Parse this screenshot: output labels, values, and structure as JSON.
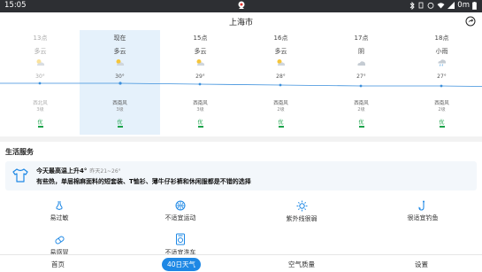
{
  "status_bar": {
    "time": "15:05",
    "bluetooth_icon": "bluetooth-icon",
    "signal_text": "0m"
  },
  "header": {
    "city": "上海市",
    "share_icon": "share-icon"
  },
  "hourly": [
    {
      "time": "13点",
      "condition": "多云",
      "icon": "partly-cloudy-icon",
      "temp": "30°",
      "wind": "西北风",
      "wind_level": "3级",
      "aqi": "优",
      "state": "past"
    },
    {
      "time": "现在",
      "condition": "多云",
      "icon": "partly-cloudy-icon",
      "temp": "30°",
      "wind": "西南风",
      "wind_level": "3级",
      "aqi": "优",
      "state": "current"
    },
    {
      "time": "15点",
      "condition": "多云",
      "icon": "partly-cloudy-icon",
      "temp": "29°",
      "wind": "西南风",
      "wind_level": "3级",
      "aqi": "优",
      "state": "future"
    },
    {
      "time": "16点",
      "condition": "多云",
      "icon": "partly-cloudy-icon",
      "temp": "28°",
      "wind": "西南风",
      "wind_level": "2级",
      "aqi": "优",
      "state": "future"
    },
    {
      "time": "17点",
      "condition": "阴",
      "icon": "overcast-icon",
      "temp": "27°",
      "wind": "西南风",
      "wind_level": "2级",
      "aqi": "优",
      "state": "future"
    },
    {
      "time": "18点",
      "condition": "小雨",
      "icon": "light-rain-icon",
      "temp": "27°",
      "wind": "西南风",
      "wind_level": "2级",
      "aqi": "优",
      "state": "future"
    }
  ],
  "life": {
    "section_title": "生活服务",
    "tip": {
      "headline": "今天最高温上升4°",
      "sub": "昨天21~26°",
      "body": "有些热，单层棉麻面料的短套装、T恤衫、薄牛仔衫裤和休闲服都是不错的选择",
      "icon": "shirt-icon"
    },
    "items": [
      {
        "label": "易过敏",
        "icon": "nose-icon"
      },
      {
        "label": "不适宜运动",
        "icon": "basketball-icon"
      },
      {
        "label": "紫外线很弱",
        "icon": "sun-icon"
      },
      {
        "label": "很适宜钓鱼",
        "icon": "fishing-hook-icon"
      },
      {
        "label": "易感冒",
        "icon": "pill-icon"
      },
      {
        "label": "不适宜洗车",
        "icon": "car-wash-icon"
      }
    ]
  },
  "bottom_nav": {
    "home": "首页",
    "forecast40": "40日天气",
    "air": "空气质量",
    "settings": "设置"
  },
  "colors": {
    "accent": "#1e88e5",
    "aqi_good": "#1aa34a",
    "highlight": "#e5f1fb",
    "status_bar": "#2d2f33"
  }
}
